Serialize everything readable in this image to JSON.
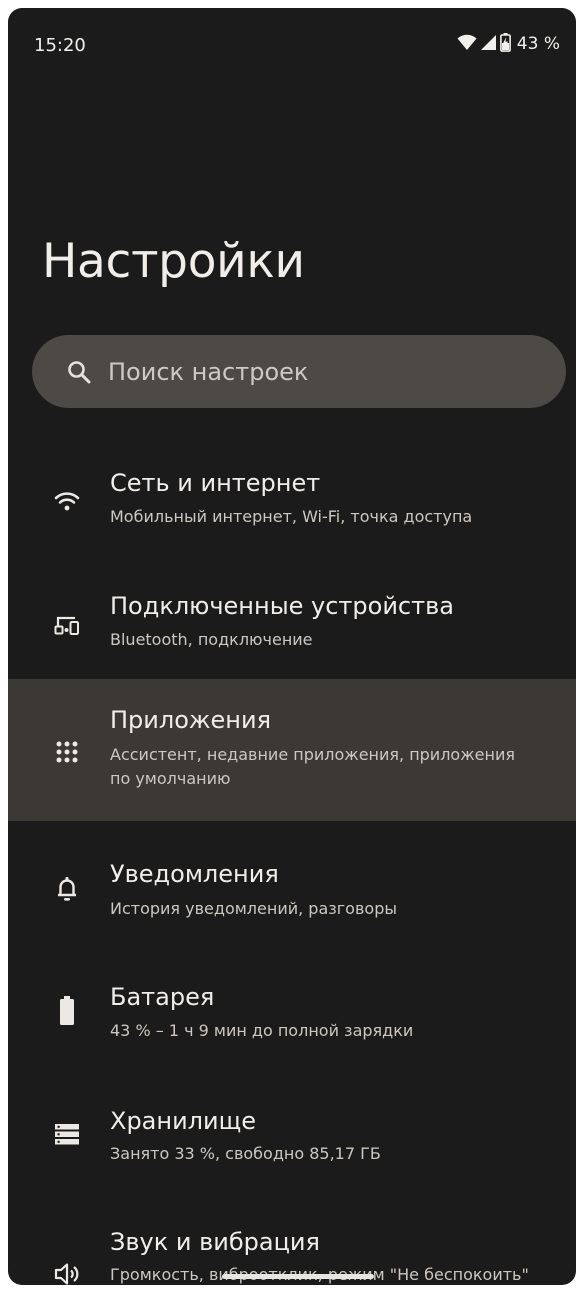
{
  "status_bar": {
    "time": "15:20",
    "battery_percent": "43 %",
    "icons": [
      "wifi-icon",
      "cell-signal-icon",
      "battery-charging-icon"
    ]
  },
  "page": {
    "title": "Настройки"
  },
  "search": {
    "placeholder": "Поиск настроек",
    "icon": "search-icon"
  },
  "items": [
    {
      "icon": "wifi-icon",
      "title": "Сеть и интернет",
      "subtitle": "Мобильный интернет, Wi-Fi, точка доступа",
      "highlighted": false
    },
    {
      "icon": "connected-devices-icon",
      "title": "Подключенные устройства",
      "subtitle": "Bluetooth, подключение",
      "highlighted": false
    },
    {
      "icon": "apps-grid-icon",
      "title": "Приложения",
      "subtitle": "Ассистент, недавние приложения, приложения по умолчанию",
      "highlighted": true
    },
    {
      "icon": "bell-icon",
      "title": "Уведомления",
      "subtitle": "История уведомлений, разговоры",
      "highlighted": false
    },
    {
      "icon": "battery-icon",
      "title": "Батарея",
      "subtitle": "43 % – 1 ч 9 мин до полной зарядки",
      "highlighted": false
    },
    {
      "icon": "storage-icon",
      "title": "Хранилище",
      "subtitle": "Занято 33 %, свободно 85,17 ГБ",
      "highlighted": false
    },
    {
      "icon": "speaker-icon",
      "title": "Звук и вибрация",
      "subtitle": "Громкость, виброотклик, режим \"Не беспокоить\"",
      "highlighted": false
    }
  ],
  "colors": {
    "background": "#1b1b1b",
    "search_bar": "#4d4944",
    "highlight": "#3c3935",
    "text_primary": "#f1eeea",
    "text_secondary": "#cdc7bf"
  }
}
